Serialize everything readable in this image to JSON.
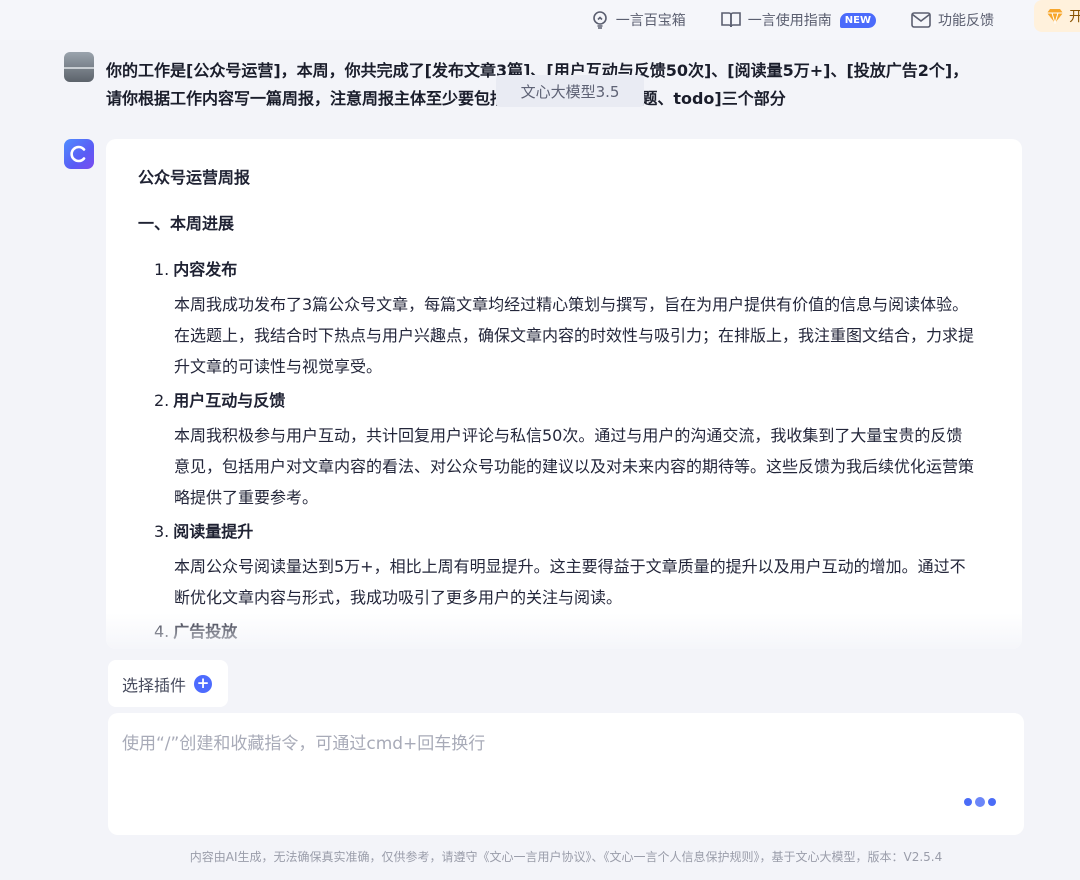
{
  "topbar": {
    "items": [
      {
        "label": "一言百宝箱",
        "icon": "bulb-icon"
      },
      {
        "label": "一言使用指南",
        "icon": "book-icon",
        "badge": "NEW"
      },
      {
        "label": "功能反馈",
        "icon": "mail-icon"
      }
    ],
    "open_label": "开",
    "colors": {
      "badge": "#4b6bfb",
      "open_bg": "#fff1dc"
    }
  },
  "conversation": {
    "user_question_line1": "你的工作是[公众号运营]，本周，你共完成了[发布文章3篇]、[用户互动与反馈50次]、[阅读量5万+]、[投放广告2个]，",
    "user_question_line2": "请你根据工作内容写一篇周报，注意周报主体至少要包括[本周进展、遇到问题、todo]三个部分",
    "tooltip": "文心大模型3.5",
    "answer": {
      "title": "公众号运营周报",
      "section1": "一、本周进展",
      "items": [
        {
          "num": "1.",
          "head": "内容发布",
          "body": "本周我成功发布了3篇公众号文章，每篇文章均经过精心策划与撰写，旨在为用户提供有价值的信息与阅读体验。在选题上，我结合时下热点与用户兴趣点，确保文章内容的时效性与吸引力；在排版上，我注重图文结合，力求提升文章的可读性与视觉享受。"
        },
        {
          "num": "2.",
          "head": "用户互动与反馈",
          "body": "本周我积极参与用户互动，共计回复用户评论与私信50次。通过与用户的沟通交流，我收集到了大量宝贵的反馈意见，包括用户对文章内容的看法、对公众号功能的建议以及对未来内容的期待等。这些反馈为我后续优化运营策略提供了重要参考。"
        },
        {
          "num": "3.",
          "head": "阅读量提升",
          "body": "本周公众号阅读量达到5万+，相比上周有明显提升。这主要得益于文章质量的提升以及用户互动的增加。通过不断优化文章内容与形式，我成功吸引了更多用户的关注与阅读。"
        },
        {
          "num": "4.",
          "head": "广告投放",
          "body": ""
        }
      ]
    }
  },
  "composer": {
    "plugin_label": "选择插件",
    "placeholder": "使用“/”创建和收藏指令，可通过cmd+回车换行",
    "value": "",
    "colors": {
      "accent": "#4d6bfe",
      "dot1": "#4a6cf7",
      "dot2": "#6b86f8",
      "dot3": "#4a6cf7"
    }
  },
  "footer": {
    "text": "内容由AI生成，无法确保真实准确，仅供参考，请遵守《文心一言用户协议》、《文心一言个人信息保护规则》，基于文心大模型，版本：V2.5.4"
  }
}
